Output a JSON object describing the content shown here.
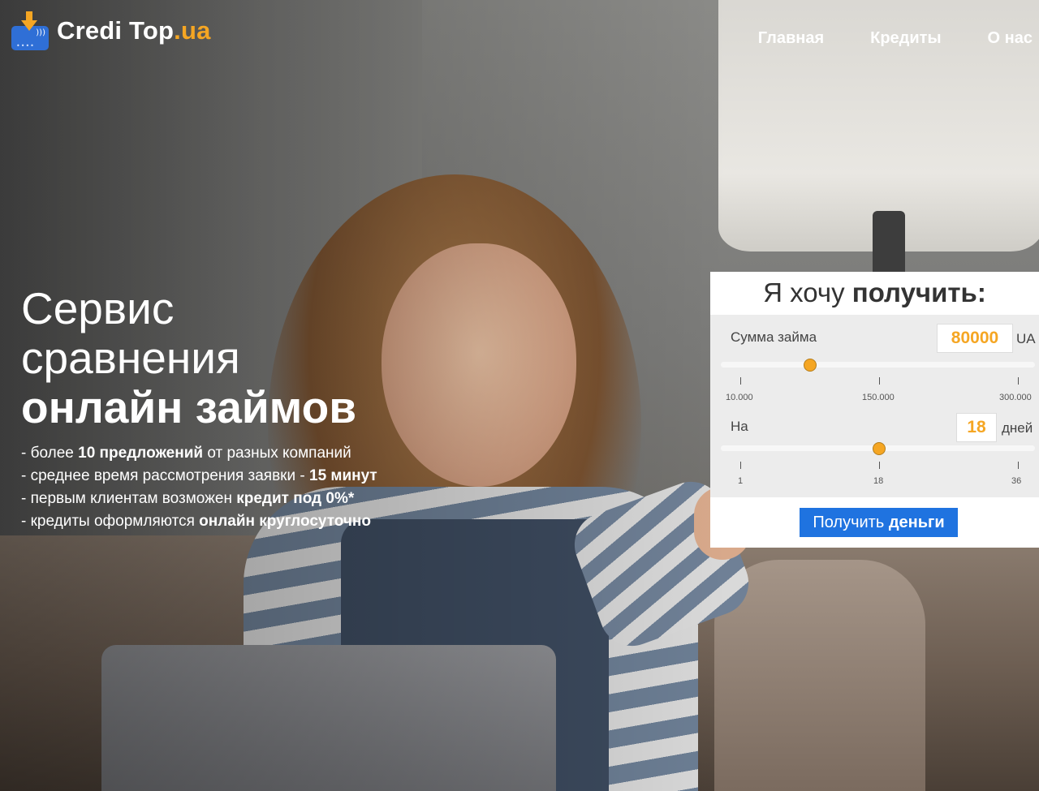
{
  "brand": {
    "name_main": "Credi Top",
    "name_tld": ".ua",
    "colors": {
      "accent": "#f5a623",
      "primary_button": "#1f73e0",
      "logo_card": "#2f6fd6"
    }
  },
  "nav": {
    "items": [
      {
        "label": "Главная"
      },
      {
        "label": "Кредиты"
      },
      {
        "label": "О нас"
      }
    ]
  },
  "hero": {
    "headline": {
      "line1": "Сервис",
      "line2": "сравнения",
      "line3": "онлайн займов"
    },
    "features": [
      {
        "prefix": "- более ",
        "bold": "10 предложений",
        "suffix": " от разных компаний"
      },
      {
        "prefix": "- среднее время рассмотрения заявки - ",
        "bold": "15 минут",
        "suffix": ""
      },
      {
        "prefix": "- первым клиентам возможен ",
        "bold": "кредит под 0%*",
        "suffix": ""
      },
      {
        "prefix": "- кредиты оформляются ",
        "bold": "онлайн круглосуточно",
        "suffix": ""
      }
    ]
  },
  "calculator": {
    "title_regular": "Я хочу ",
    "title_bold": "получить:",
    "amount": {
      "label": "Сумма займа",
      "value": "80000",
      "unit": "UA",
      "slider_value": 80000,
      "min": 10000,
      "max": 300000,
      "ticks": [
        "10.000",
        "150.000",
        "300.000"
      ]
    },
    "term": {
      "label": "На",
      "value": "18",
      "unit": "дней",
      "slider_value": 18,
      "min": 1,
      "max": 36,
      "ticks": [
        "1",
        "18",
        "36"
      ]
    },
    "button_regular": "Получить ",
    "button_bold": "деньги"
  }
}
